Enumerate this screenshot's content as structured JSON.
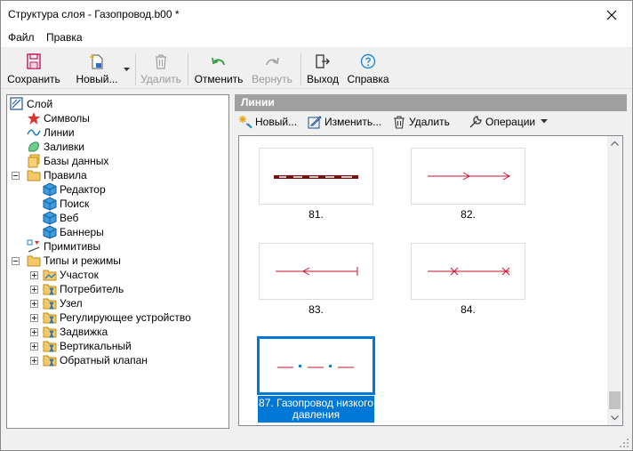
{
  "window": {
    "title": "Структура слоя - Газопровод.b00 *"
  },
  "menu": {
    "file": "Файл",
    "help": "Правка"
  },
  "toolbar": {
    "save": "Сохранить",
    "new": "Новый...",
    "delete": "Удалить",
    "undo": "Отменить",
    "redo": "Вернуть",
    "exit": "Выход",
    "help": "Справка"
  },
  "tree": {
    "root": "Слой",
    "symbols": "Символы",
    "lines": "Линии",
    "fills": "Заливки",
    "databases": "Базы данных",
    "rules": "Правила",
    "editor": "Редактор",
    "search": "Поиск",
    "web": "Веб",
    "banners": "Баннеры",
    "primitives": "Примитивы",
    "types": "Типы и режимы",
    "t1": "Участок",
    "t2": "Потребитель",
    "t3": "Узел",
    "t4": "Регулирующее устройство",
    "t5": "Задвижка",
    "t6": "Вертикальный",
    "t7": "Обратный клапан"
  },
  "panel": {
    "header": "Линии",
    "new": "Новый...",
    "edit": "Изменить...",
    "delete": "Удалить",
    "ops": "Операции"
  },
  "tiles": {
    "c81": "81.",
    "c82": "82.",
    "c83": "83.",
    "c84": "84.",
    "c87a": "87. Газопровод низкого",
    "c87b": "давления"
  },
  "colors": {
    "accent": "#0078d7",
    "line_red": "#c8102e"
  }
}
